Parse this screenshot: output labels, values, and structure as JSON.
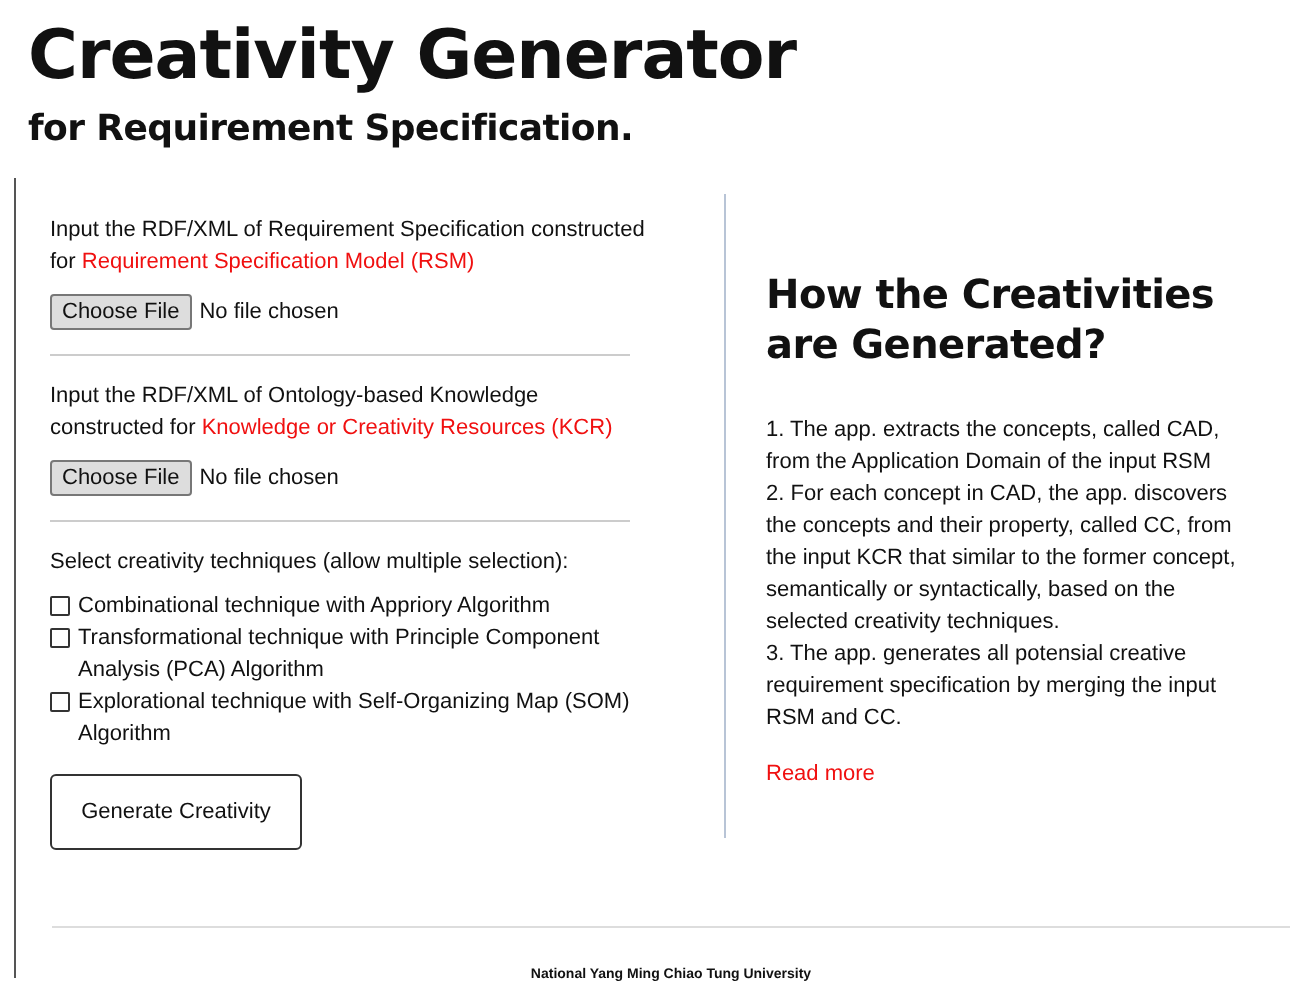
{
  "title": "Creativity Generator",
  "subtitle": "for Requirement Specification.",
  "uploads": [
    {
      "label": "Input the RDF/XML of Requirement Specification constructed for",
      "highlight": "Requirement Specification Model (RSM)",
      "button": "Choose File",
      "status": "No file chosen"
    },
    {
      "label": "Input the RDF/XML of Ontology-based Knowledge constructed for",
      "highlight": "Knowledge or Creativity Resources (KCR)",
      "button": "Choose File",
      "status": "No file chosen"
    }
  ],
  "techniques": {
    "label": "Select creativity techniques (allow multiple selection):",
    "options": [
      {
        "label": "Combinational technique with Appriory Algorithm",
        "checked": false
      },
      {
        "label": "Transformational technique with Principle Component Analysis (PCA) Algorithm",
        "checked": false
      },
      {
        "label": "Explorational technique with Self-Organizing Map (SOM) Algorithm",
        "checked": false
      }
    ]
  },
  "generate_button": "Generate Creativity",
  "info": {
    "heading": "How the Creativities are Generated?",
    "steps": [
      "1. The app. extracts the concepts, called CAD, from the Application Domain of the input RSM",
      "2. For each concept in CAD, the app. discovers the concepts and their property, called CC, from the input KCR that similar to the former concept, semantically or syntactically, based on the selected creativity techniques.",
      "3. The app. generates all potensial creative requirement specification by merging the input RSM and CC."
    ],
    "link": "Read more"
  },
  "footer": "National Yang Ming Chiao Tung University"
}
